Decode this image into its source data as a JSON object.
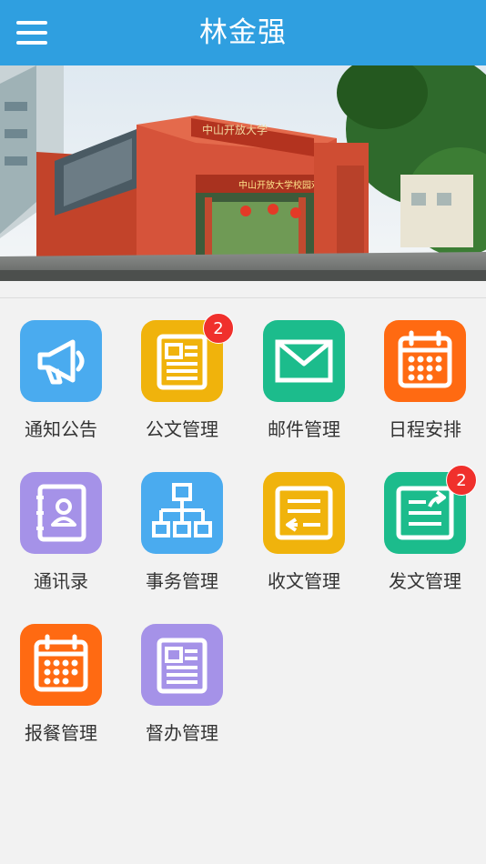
{
  "header": {
    "title": "林金强",
    "menu_icon": "hamburger-menu-icon"
  },
  "banner": {
    "description_icon": "campus-gate-photo",
    "gate_signboard": "中山开放大学",
    "gate_banner": "中山开放大学校园欢迎"
  },
  "colors": {
    "header": "#2f9fe0",
    "blue": "#4aabef",
    "yellow": "#f0b30c",
    "green": "#1cbc8c",
    "orange": "#ff6a12",
    "purple": "#a592e8",
    "badge": "#f0302c"
  },
  "apps": [
    {
      "label": "通知公告",
      "icon": "megaphone-icon",
      "color": "#4aabef",
      "badge": ""
    },
    {
      "label": "公文管理",
      "icon": "document-icon",
      "color": "#f0b30c",
      "badge": "2"
    },
    {
      "label": "邮件管理",
      "icon": "mail-icon",
      "color": "#1cbc8c",
      "badge": ""
    },
    {
      "label": "日程安排",
      "icon": "calendar-icon",
      "color": "#ff6a12",
      "badge": ""
    },
    {
      "label": "通讯录",
      "icon": "contacts-book-icon",
      "color": "#a592e8",
      "badge": ""
    },
    {
      "label": "事务管理",
      "icon": "org-chart-icon",
      "color": "#4aabef",
      "badge": ""
    },
    {
      "label": "收文管理",
      "icon": "inbox-document-icon",
      "color": "#f0b30c",
      "badge": ""
    },
    {
      "label": "发文管理",
      "icon": "send-document-icon",
      "color": "#1cbc8c",
      "badge": "2"
    },
    {
      "label": "报餐管理",
      "icon": "calendar-icon",
      "color": "#ff6a12",
      "badge": ""
    },
    {
      "label": "督办管理",
      "icon": "document-icon",
      "color": "#a592e8",
      "badge": ""
    }
  ]
}
